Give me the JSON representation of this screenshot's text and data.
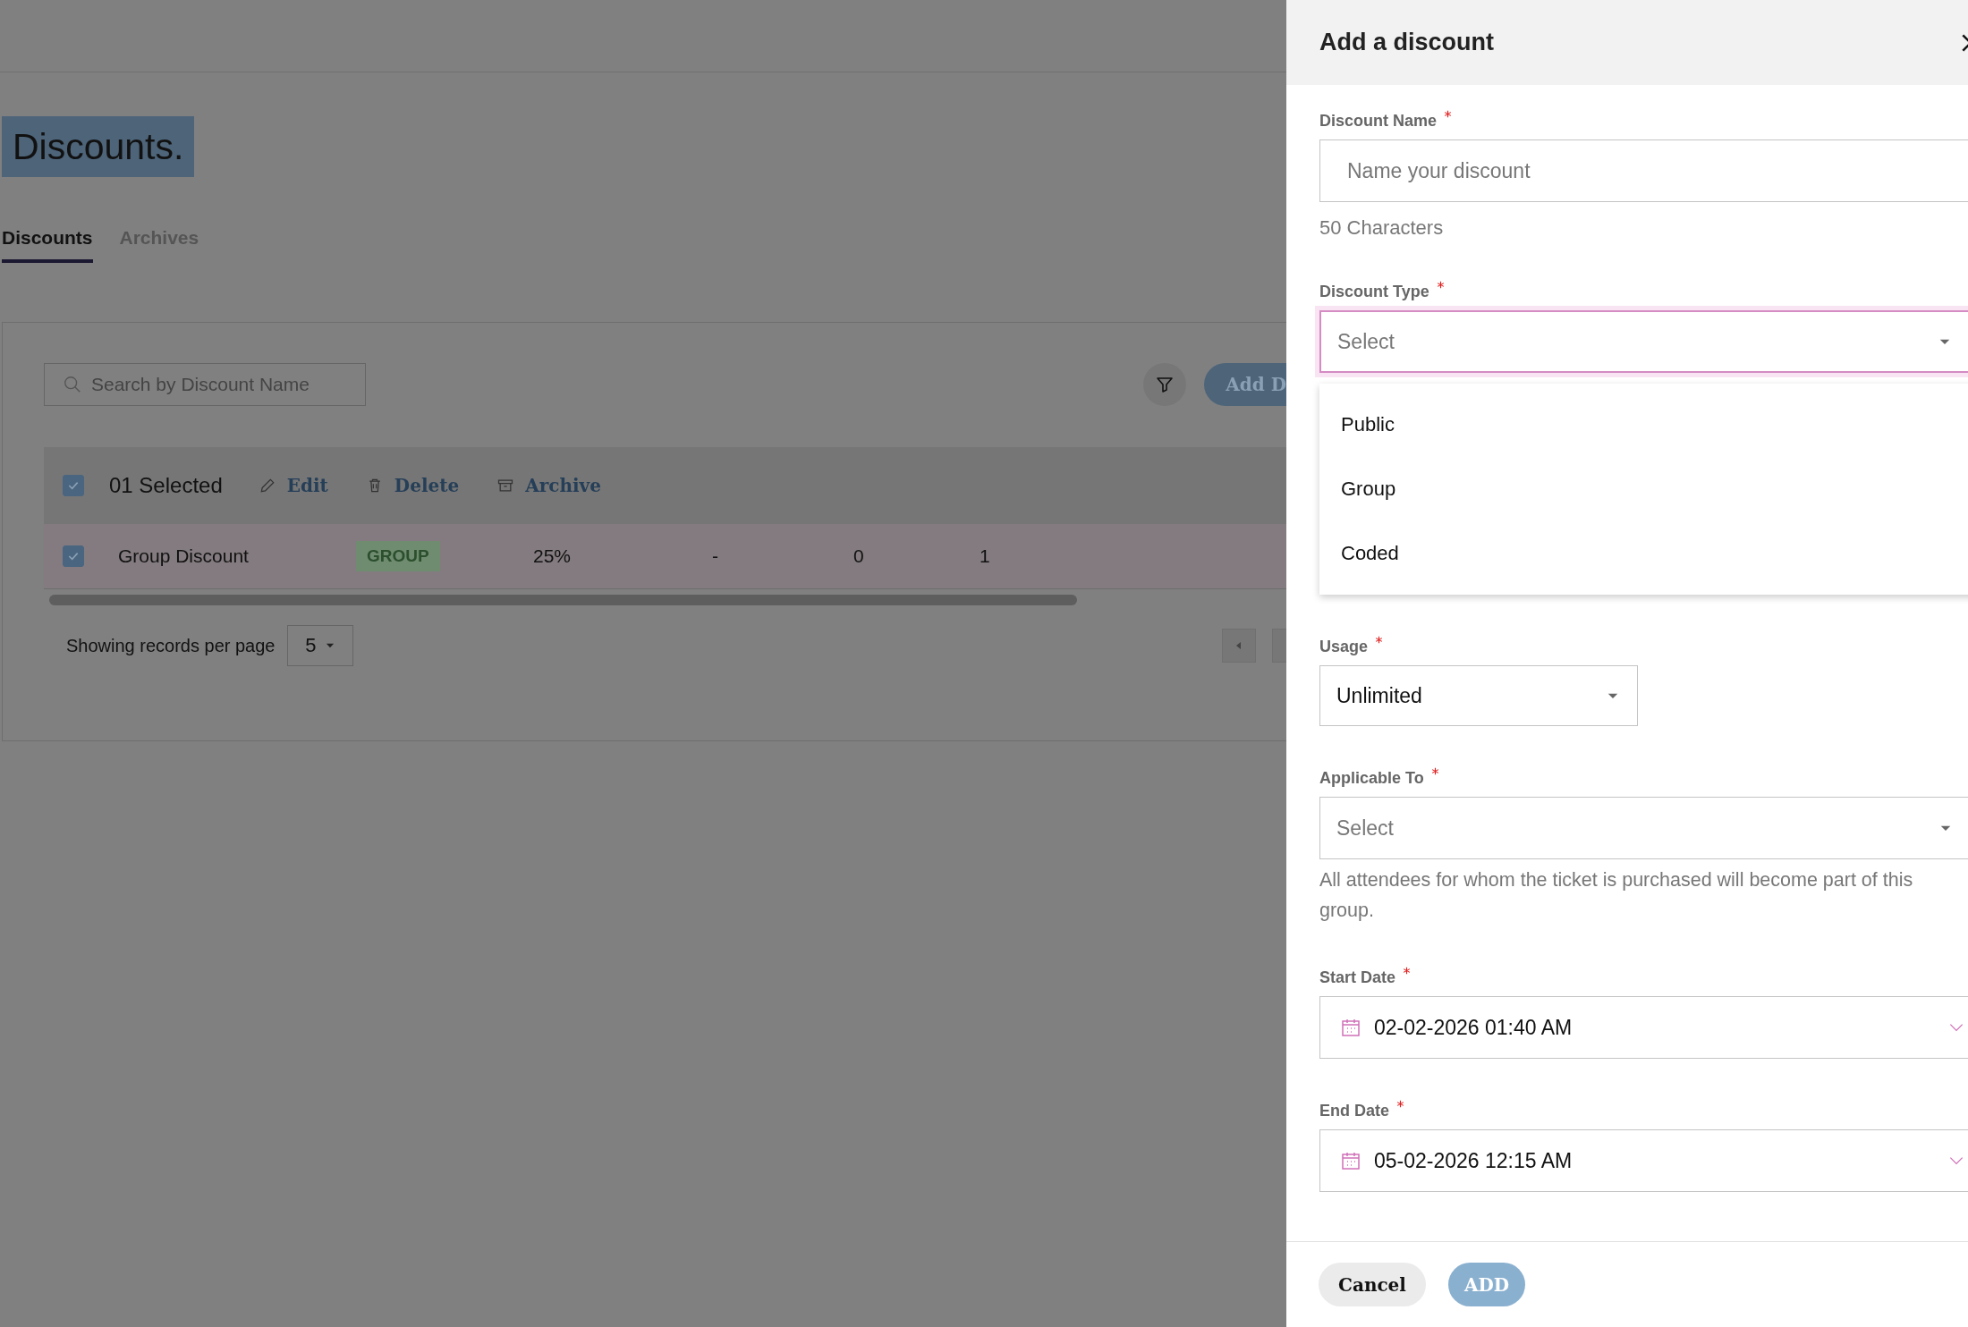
{
  "page": {
    "title": "Discounts.",
    "tabs": [
      {
        "label": "Discounts",
        "selected": true
      },
      {
        "label": "Archives",
        "selected": false
      }
    ],
    "search": {
      "placeholder": "Search by Discount Name"
    },
    "add_button": "Add D",
    "bulk_bar": {
      "checked": true,
      "count": "01 Selected",
      "actions": [
        {
          "kind": "edit",
          "label": "Edit"
        },
        {
          "kind": "delete",
          "label": "Delete"
        },
        {
          "kind": "archive",
          "label": "Archive"
        }
      ]
    },
    "rows": [
      {
        "checked": true,
        "name": "Group Discount",
        "type": "GROUP",
        "value": "25%",
        "column_4": "-",
        "column_5": "0",
        "column_6": "1"
      }
    ],
    "pagination": {
      "label": "Showing records per page",
      "per_page": "5"
    }
  },
  "drawer": {
    "title": "Add a discount",
    "fields": [
      {
        "kind": "text",
        "label": "Discount Name",
        "required": true,
        "placeholder": "Name your discount",
        "hint": "50 Characters"
      },
      {
        "kind": "select",
        "label": "Discount Type",
        "required": true,
        "placeholder": "Select",
        "focused": true,
        "expanded": true,
        "options": [
          {
            "label": "Public",
            "selected": false
          },
          {
            "label": "Group",
            "selected": false
          },
          {
            "label": "Coded",
            "selected": false
          }
        ]
      },
      {
        "kind": "short-select",
        "label": "Usage",
        "required": true,
        "value": "Unlimited",
        "focused": false,
        "expanded": false
      },
      {
        "kind": "select",
        "label": "Applicable To",
        "required": true,
        "placeholder": "Select",
        "focused": false,
        "expanded": false,
        "hint": "All attendees for whom the ticket is purchased will become part of this group."
      },
      {
        "kind": "date",
        "label": "Start Date",
        "required": true,
        "value": "02-02-2026 01:40 AM"
      },
      {
        "kind": "date",
        "label": "End Date",
        "required": true,
        "value": "05-02-2026 12:15 AM"
      }
    ],
    "buttons": [
      {
        "kind": "secondary",
        "label": "Cancel",
        "disabled": false
      },
      {
        "kind": "primary",
        "label": "ADD",
        "disabled": true
      }
    ]
  }
}
